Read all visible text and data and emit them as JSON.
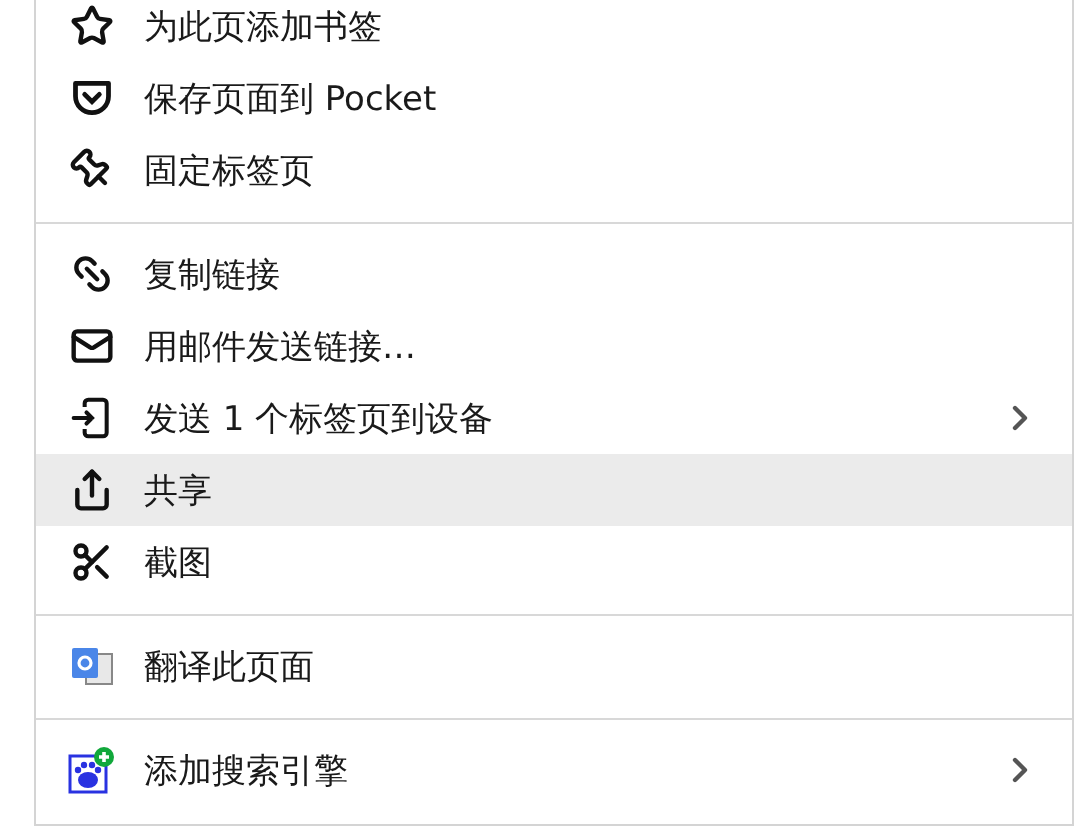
{
  "menu": {
    "sections": [
      {
        "items": [
          {
            "kind": "star",
            "label": "为此页添加书签",
            "submenu": false,
            "selected": false
          },
          {
            "kind": "pocket",
            "label": "保存页面到 Pocket",
            "submenu": false,
            "selected": false
          },
          {
            "kind": "pin",
            "label": "固定标签页",
            "submenu": false,
            "selected": false
          }
        ]
      },
      {
        "items": [
          {
            "kind": "link",
            "label": "复制链接",
            "submenu": false,
            "selected": false
          },
          {
            "kind": "mail",
            "label": "用邮件发送链接…",
            "submenu": false,
            "selected": false
          },
          {
            "kind": "device",
            "label": "发送 1 个标签页到设备",
            "submenu": true,
            "selected": false
          },
          {
            "kind": "share",
            "label": "共享",
            "submenu": false,
            "selected": true
          },
          {
            "kind": "screenshot",
            "label": "截图",
            "submenu": false,
            "selected": false
          }
        ]
      },
      {
        "items": [
          {
            "kind": "translate",
            "label": "翻译此页面",
            "submenu": false,
            "selected": false
          }
        ]
      },
      {
        "items": [
          {
            "kind": "search-engine",
            "label": "添加搜索引擎",
            "submenu": true,
            "selected": false
          }
        ]
      }
    ]
  }
}
